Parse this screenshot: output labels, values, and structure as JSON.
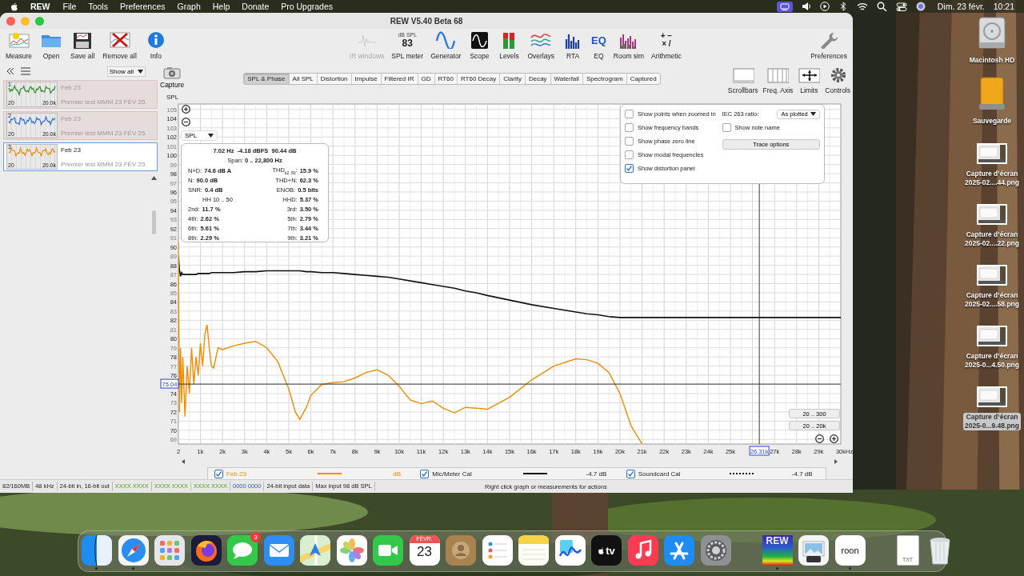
{
  "menu_bar": {
    "app": "REW",
    "items": [
      "File",
      "Tools",
      "Preferences",
      "Graph",
      "Help",
      "Donate",
      "Pro Upgrades"
    ],
    "date": "Dim. 23 févr.",
    "time": "10:21"
  },
  "window": {
    "title": "REW V5.40 Beta 68"
  },
  "toolbar": {
    "left": [
      {
        "label": "Measure",
        "kind": "measure"
      },
      {
        "label": "Open",
        "kind": "open"
      },
      {
        "label": "Save all",
        "kind": "save"
      },
      {
        "label": "Remove all",
        "kind": "remove"
      },
      {
        "label": "Info",
        "kind": "info"
      }
    ],
    "center": [
      {
        "label": "IR windows",
        "kind": "ir",
        "disabled": true
      },
      {
        "label": "SPL meter",
        "kind": "meter",
        "caption": "dB SPL",
        "reading": "83",
        "disabled": false
      },
      {
        "label": "Generator",
        "kind": "generator",
        "disabled": false
      },
      {
        "label": "Scope",
        "kind": "scope",
        "disabled": false
      },
      {
        "label": "Levels",
        "kind": "levels",
        "disabled": false
      },
      {
        "label": "Overlays",
        "kind": "overlays",
        "disabled": false
      },
      {
        "label": "RTA",
        "kind": "rta",
        "disabled": false
      },
      {
        "label": "EQ",
        "kind": "eq",
        "glyph": "EQ",
        "disabled": false
      },
      {
        "label": "Room sim",
        "kind": "roomsim",
        "disabled": false
      },
      {
        "label": "Arithmetic",
        "kind": "arithmetic",
        "glyph_lines": [
          "+ −",
          "× /"
        ],
        "disabled": false
      }
    ],
    "right": [
      {
        "label": "Preferences",
        "kind": "wrench"
      }
    ]
  },
  "left_panel": {
    "filter": "Show all",
    "measurements": [
      {
        "number": "1",
        "title": "Feb 23",
        "description": "Premier test MMM 23 FÉV 25.",
        "axis_min": "20",
        "axis_max": "20.0k",
        "color": "#2e8b2e",
        "selected": false
      },
      {
        "number": "2",
        "title": "Feb 23",
        "description": "Premier test MMM 23 FÉV 25.",
        "axis_min": "20",
        "axis_max": "20.0k",
        "color": "#2a6fd6",
        "selected": false
      },
      {
        "number": "3",
        "title": "Feb 23",
        "description": "Premier test MMM 23 FÉV 25.",
        "axis_min": "20",
        "axis_max": "20.0k",
        "color": "#f08c00",
        "selected": true
      }
    ]
  },
  "graph_toolbar": {
    "capture": "Capture",
    "tabs": [
      {
        "label": "SPL & Phase",
        "selected": true
      },
      {
        "label": "All SPL",
        "selected": false
      },
      {
        "label": "Distortion",
        "selected": false
      },
      {
        "label": "Impulse",
        "selected": false
      },
      {
        "label": "Filtered IR",
        "selected": false
      },
      {
        "label": "GD",
        "selected": false
      },
      {
        "label": "RT60",
        "selected": false
      },
      {
        "label": "RT60 Decay",
        "selected": false
      },
      {
        "label": "Clarity",
        "selected": false
      },
      {
        "label": "Decay",
        "selected": false
      },
      {
        "label": "Waterfall",
        "selected": false
      },
      {
        "label": "Spectrogram",
        "selected": false
      },
      {
        "label": "Captured",
        "selected": false
      }
    ],
    "controls": [
      {
        "label": "Scrollbars",
        "kind": "scrollbars"
      },
      {
        "label": "Freq. Axis",
        "kind": "freqaxis"
      },
      {
        "label": "Limits",
        "kind": "limits"
      },
      {
        "label": "Controls",
        "kind": "controls"
      }
    ]
  },
  "graph": {
    "trace_dropdown": "SPL",
    "distortion_panel": {
      "readout": "7.02 Hz  -4.18 dBFS  90.44 dB",
      "span": "Span: **0 .. 22,800 Hz**",
      "rows": [
        {
          "left_label": "N+D:",
          "left_value": "74.6 dB A",
          "right_label": "THD$_{k2..50}$:",
          "right_value": "15.9 %"
        },
        {
          "left_label": "N:",
          "left_value": "90.0 dB",
          "right_label": "THD+N:",
          "right_value": "62.3 %"
        },
        {
          "left_label": "SNR:",
          "left_value": "0.4 dB",
          "right_label": "ENOB:",
          "right_value": "0.5 bits"
        },
        {
          "left_label": "HH 10 .. 50",
          "right_label": "HHD:",
          "right_value": "5.37 %"
        },
        {
          "left_label": "2nd:",
          "left_value": "11.7 %",
          "right_label": "3rd:",
          "right_value": "3.50 %"
        },
        {
          "left_label": "4th:",
          "left_value": "2.62 %",
          "right_label": "5th:",
          "right_value": "2.79 %"
        },
        {
          "left_label": "6th:",
          "left_value": "5.61 %",
          "right_label": "7th:",
          "right_value": "3.44 %"
        },
        {
          "left_label": "8th:",
          "left_value": "2.29 %",
          "right_label": "9th:",
          "right_value": "3.21 %"
        }
      ]
    },
    "options_panel": {
      "checkboxes": [
        {
          "label": "Show points when zoomed in",
          "checked": false
        },
        {
          "label": "Show frequency bands",
          "checked": false
        },
        {
          "label": "Show phase zero line",
          "checked": false
        },
        {
          "label": "Show modal frequencies",
          "checked": false
        },
        {
          "label": "Show distortion panel",
          "checked": true
        }
      ],
      "ratio_label": "IEC 263 ratio:",
      "ratio_value": "As plotted",
      "note_checkbox": {
        "label": "Show note name",
        "checked": false
      },
      "button": "Trace options"
    },
    "range_buttons": [
      "20 .. 300",
      "20 .. 20k"
    ],
    "chart_data": {
      "type": "line",
      "xlabel": "Hz",
      "ylabel": "SPL",
      "xlim": [
        2,
        30000
      ],
      "ylim": [
        68.5,
        105.6
      ],
      "x": [
        2,
        50,
        100,
        150,
        200,
        300,
        400,
        500,
        600,
        700,
        800,
        900,
        1000,
        1100,
        1200,
        1300,
        1400,
        1500,
        1600,
        1800,
        2000,
        2500,
        3000,
        3500,
        4000,
        4500,
        5000,
        5300,
        5500,
        5800,
        6000,
        6500,
        7000,
        7500,
        8000,
        8500,
        9000,
        9500,
        10000,
        10500,
        11000,
        11500,
        12000,
        12500,
        13000,
        13500,
        14000,
        15000,
        16000,
        17000,
        18000,
        18500,
        19000,
        19500,
        20000,
        20500,
        21000,
        22000,
        24000,
        26000,
        28000,
        30000
      ],
      "series": [
        {
          "color": "#111111",
          "values": [
            89,
            87.5,
            86.8,
            87.2,
            87,
            87,
            87,
            87,
            87,
            87,
            87,
            87.1,
            87.1,
            87.1,
            87.1,
            87.1,
            87.1,
            87.2,
            87.2,
            87.2,
            87.2,
            87.2,
            87.3,
            87.3,
            87.4,
            87.4,
            87.4,
            87.4,
            87.4,
            87.3,
            87.3,
            87.2,
            87.2,
            87.1,
            87,
            86.9,
            86.8,
            86.7,
            86.5,
            86.3,
            86.1,
            85.9,
            85.7,
            85.5,
            85.2,
            85,
            84.7,
            84.2,
            83.7,
            83.3,
            82.9,
            82.7,
            82.6,
            82.4,
            82.3,
            82.3,
            82.3,
            82.3,
            82.3,
            82.3,
            82.3,
            82.3
          ]
        },
        {
          "color": "#f08c00",
          "values": [
            90.5,
            72,
            79,
            73,
            78,
            71.5,
            77,
            74,
            79,
            75,
            78,
            76,
            79.5,
            77,
            80.5,
            81.5,
            79,
            77,
            76.8,
            79,
            78.8,
            79.2,
            79.5,
            79.7,
            79,
            77.5,
            74.5,
            72,
            71.2,
            72.5,
            73.8,
            75,
            75.2,
            75.3,
            75.7,
            76.3,
            76.6,
            76,
            74.8,
            73.3,
            72.9,
            73.2,
            72.4,
            71.9,
            72.5,
            72.4,
            72.3,
            73.6,
            75.5,
            77,
            77.8,
            77.7,
            77.3,
            76.3,
            74,
            70.5,
            68.5,
            null,
            null,
            null,
            null,
            null
          ]
        }
      ],
      "grid": true,
      "yticks": [
        69,
        70,
        71,
        72,
        73,
        74,
        76,
        77,
        78,
        79,
        80,
        81,
        82,
        83,
        84,
        85,
        86,
        87,
        88,
        89,
        90,
        91,
        92,
        93,
        94,
        95,
        96,
        97,
        98,
        99,
        100,
        101,
        102,
        103,
        104,
        105
      ],
      "xticks": [
        {
          "value": 2,
          "label": "2"
        },
        {
          "value": 1000,
          "label": "1k"
        },
        {
          "value": 2000,
          "label": "2k"
        },
        {
          "value": 3000,
          "label": "3k"
        },
        {
          "value": 4000,
          "label": "4k"
        },
        {
          "value": 5000,
          "label": "5k"
        },
        {
          "value": 6000,
          "label": "6k"
        },
        {
          "value": 7000,
          "label": "7k"
        },
        {
          "value": 8000,
          "label": "8k"
        },
        {
          "value": 9000,
          "label": "9k"
        },
        {
          "value": 10000,
          "label": "10k"
        },
        {
          "value": 11000,
          "label": "11k"
        },
        {
          "value": 12000,
          "label": "12k"
        },
        {
          "value": 13000,
          "label": "13k"
        },
        {
          "value": 14000,
          "label": "14k"
        },
        {
          "value": 15000,
          "label": "15k"
        },
        {
          "value": 16000,
          "label": "16k"
        },
        {
          "value": 17000,
          "label": "17k"
        },
        {
          "value": 18000,
          "label": "18k"
        },
        {
          "value": 19000,
          "label": "19k"
        },
        {
          "value": 20000,
          "label": "20k"
        },
        {
          "value": 21000,
          "label": "21k"
        },
        {
          "value": 22000,
          "label": "22k"
        },
        {
          "value": 23000,
          "label": "23k"
        },
        {
          "value": 24000,
          "label": "24k"
        },
        {
          "value": 25000,
          "label": "25k"
        },
        {
          "value": 27000,
          "label": "27k"
        },
        {
          "value": 28000,
          "label": "28k"
        },
        {
          "value": 29000,
          "label": "29k"
        },
        {
          "value": 30000,
          "label": "30k"
        }
      ],
      "ref_lines": [
        {
          "axis": "y",
          "value": 75.04,
          "label": "75.04"
        },
        {
          "axis": "x",
          "value": 26310,
          "label": "26.31k"
        }
      ]
    }
  },
  "legend": [
    {
      "label": "Feb 23",
      "checked": true,
      "color": "#f08c00",
      "kind": "solid",
      "reading": "dB"
    },
    {
      "label": "Mic/Meter Cal",
      "checked": true,
      "color": "#111111",
      "kind": "solid",
      "reading": "-4.7 dB"
    },
    {
      "label": "Soundcard Cal",
      "checked": true,
      "color": "#111111",
      "kind": "dotted",
      "reading": "-4.7 dB"
    }
  ],
  "status_bar": {
    "cells": [
      {
        "text": "82/160MB",
        "kind": "info"
      },
      {
        "text": "48 kHz",
        "kind": "info"
      },
      {
        "text": "24-bit in, 16-bit out",
        "kind": "info"
      },
      {
        "text": "XXXX XXXX",
        "kind": "input"
      },
      {
        "text": "XXXX XXXX",
        "kind": "input"
      },
      {
        "text": "XXXX XXXX",
        "kind": "input"
      },
      {
        "text": "0000 0000",
        "kind": "output"
      },
      {
        "text": "24-bit input data",
        "kind": "info"
      },
      {
        "text": "Max input 98 dB SPL",
        "kind": "info"
      }
    ],
    "message": "Right click graph or measurements for actions"
  },
  "desktop_icons": [
    {
      "kind": "disk",
      "lines": [
        "Macintosh HD"
      ],
      "selected": false
    },
    {
      "kind": "drive",
      "lines": [
        "Sauvegarde"
      ],
      "selected": false
    },
    {
      "kind": "screenshot",
      "lines": [
        "Capture d’écran",
        "2025-02....44.png"
      ],
      "selected": false
    },
    {
      "kind": "screenshot",
      "lines": [
        "Capture d’écran",
        "2025-02....22.png"
      ],
      "selected": false
    },
    {
      "kind": "screenshot",
      "lines": [
        "Capture d’écran",
        "2025-02....58.png"
      ],
      "selected": false
    },
    {
      "kind": "screenshot",
      "lines": [
        "Capture d’écran",
        "2025-0...4.50.png"
      ],
      "selected": false
    },
    {
      "kind": "screenshot",
      "lines": [
        "Capture d’écran",
        "2025-0...9.48.png"
      ],
      "selected": true
    }
  ],
  "dock": {
    "sections": [
      [
        {
          "kind": "finder",
          "running": true
        },
        {
          "kind": "safari",
          "running": true
        },
        {
          "kind": "launchpad",
          "running": false
        },
        {
          "kind": "firefox",
          "running": false
        },
        {
          "kind": "messages",
          "running": false,
          "badge": "3"
        },
        {
          "kind": "mail",
          "running": false
        },
        {
          "kind": "maps",
          "running": false
        },
        {
          "kind": "photos",
          "running": false
        },
        {
          "kind": "facetime",
          "running": false
        },
        {
          "kind": "calendar",
          "running": false,
          "month": "FÉVR.",
          "day": "23"
        },
        {
          "kind": "contacts",
          "running": false
        },
        {
          "kind": "reminders",
          "running": false
        },
        {
          "kind": "notes",
          "running": false
        },
        {
          "kind": "freeform",
          "running": false
        },
        {
          "kind": "tv",
          "running": false,
          "text": "tv"
        },
        {
          "kind": "music",
          "running": false
        },
        {
          "kind": "appstore",
          "running": false
        },
        {
          "kind": "settings",
          "running": false
        }
      ],
      [
        {
          "kind": "rew",
          "running": true,
          "text": "REW"
        },
        {
          "kind": "preview",
          "running": false
        },
        {
          "kind": "roon",
          "running": true,
          "text": "roon"
        }
      ],
      [
        {
          "kind": "file",
          "running": false,
          "text": "TXT"
        },
        {
          "kind": "trash",
          "running": false
        }
      ]
    ]
  }
}
